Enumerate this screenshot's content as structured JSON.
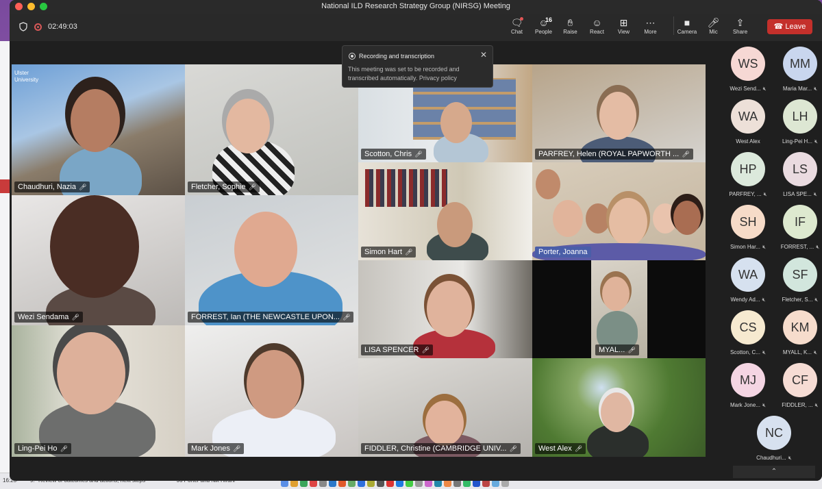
{
  "window": {
    "title": "National ILD Research Strategy Group (NIRSG) Meeting"
  },
  "toolbar": {
    "timer": "02:49:03",
    "participant_count": "16",
    "buttons": [
      {
        "label": "Chat",
        "icon": "chat-icon"
      },
      {
        "label": "People",
        "icon": "people-icon"
      },
      {
        "label": "Raise",
        "icon": "hand-icon"
      },
      {
        "label": "React",
        "icon": "smiley-icon"
      },
      {
        "label": "View",
        "icon": "grid-icon"
      },
      {
        "label": "More",
        "icon": "more-icon"
      },
      {
        "label": "Camera",
        "icon": "camera-icon"
      },
      {
        "label": "Mic",
        "icon": "mic-icon"
      },
      {
        "label": "Share",
        "icon": "share-icon"
      }
    ],
    "leave_label": "Leave"
  },
  "toast": {
    "title": "Recording and transcription",
    "body": "This meeting was set to be recorded and transcribed automatically. Privacy policy"
  },
  "tiles": [
    {
      "name": "Chaudhuri, Nazia"
    },
    {
      "name": "Fletcher, Sophie"
    },
    {
      "name": "Scotton, Chris"
    },
    {
      "name": "PARFREY, Helen (ROYAL PAPWORTH ..."
    },
    {
      "name": "Simon Hart"
    },
    {
      "name": "Porter, Joanna"
    },
    {
      "name": "Wezi Sendama"
    },
    {
      "name": "FORREST, Ian (THE NEWCASTLE UPON..."
    },
    {
      "name": "LISA SPENCER"
    },
    {
      "name": "MYAL..."
    },
    {
      "name": "Ling-Pei Ho"
    },
    {
      "name": "Mark Jones"
    },
    {
      "name": "FIDDLER, Christine (CAMBRIDGE UNIV..."
    },
    {
      "name": "West Alex"
    }
  ],
  "roster": [
    {
      "initials": "WS",
      "label": "Wezi Send...",
      "color": "#f6d8d4"
    },
    {
      "initials": "MM",
      "label": "Maria Mar...",
      "color": "#c9d6ee"
    },
    {
      "initials": "WA",
      "label": "West Alex",
      "color": "#ede0d8"
    },
    {
      "initials": "LH",
      "label": "Ling-Pei H...",
      "color": "#dde7d3"
    },
    {
      "initials": "HP",
      "label": "PARFREY, ...",
      "color": "#dce9dc"
    },
    {
      "initials": "LS",
      "label": "LISA SPE...",
      "color": "#eadbe0"
    },
    {
      "initials": "SH",
      "label": "Simon Har...",
      "color": "#f6dbc8"
    },
    {
      "initials": "IF",
      "label": "FORREST, ...",
      "color": "#dde9cf"
    },
    {
      "initials": "WA",
      "label": "Wendy Ad...",
      "color": "#d6e1ef"
    },
    {
      "initials": "SF",
      "label": "Fletcher, S...",
      "color": "#d2e6dd"
    },
    {
      "initials": "CS",
      "label": "Scotton, C...",
      "color": "#f6ead0"
    },
    {
      "initials": "KM",
      "label": "MYALL, K...",
      "color": "#f6dccc"
    },
    {
      "initials": "MJ",
      "label": "Mark Jone...",
      "color": "#f4d5e3"
    },
    {
      "initials": "CF",
      "label": "FIDDLER, ...",
      "color": "#f6dcd4"
    },
    {
      "initials": "NC",
      "label": "Chaudhuri...",
      "color": "#d7e1ef"
    }
  ],
  "background": {
    "doc_lines": [
      {
        "label": "16:25-",
        "row": "9.",
        "text": "Review of outcomes and actions, next steps",
        "owner": "Jo Porter and Nik Hirani"
      }
    ],
    "logo_text": "Ulster University"
  }
}
